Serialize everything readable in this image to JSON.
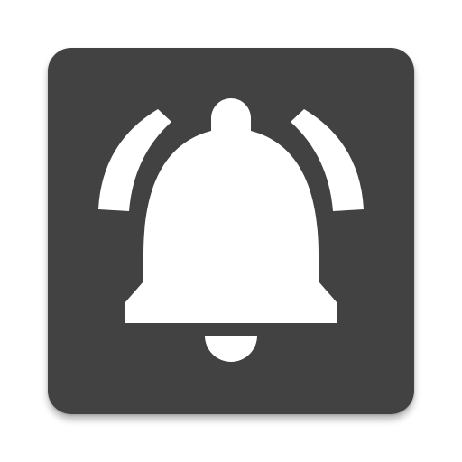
{
  "app_icon": {
    "icon": "notification-bell-icon",
    "colors": {
      "background": "#424242",
      "foreground": "#ffffff"
    }
  }
}
